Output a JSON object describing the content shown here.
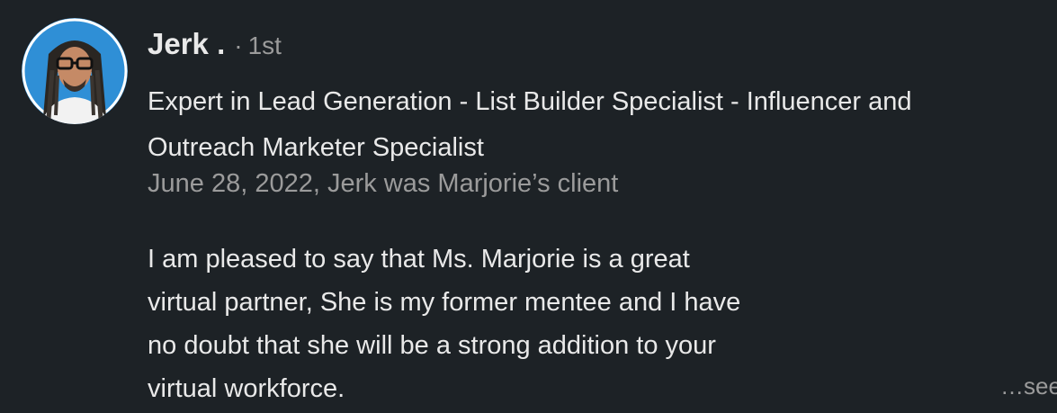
{
  "recommender": {
    "name": "Jerk .",
    "degree_separator": "·",
    "degree": "1st",
    "headline_lines": [
      "Expert in Lead Generation - List Builder Specialist - Influencer and",
      "Outreach Marketer Specialist"
    ],
    "relationship": "June 28, 2022, Jerk was Marjorie’s client"
  },
  "recommendation": {
    "text_lines": [
      "I am pleased to say that Ms. Marjorie is a great",
      "virtual partner, She is my former mentee and I have",
      "no doubt that she will be a strong addition to your",
      "virtual workforce."
    ],
    "see_more_label": "…see"
  },
  "colors": {
    "background": "#1d2226",
    "primary_text": "#e9e9e9",
    "secondary_text": "#9b9b9b"
  }
}
